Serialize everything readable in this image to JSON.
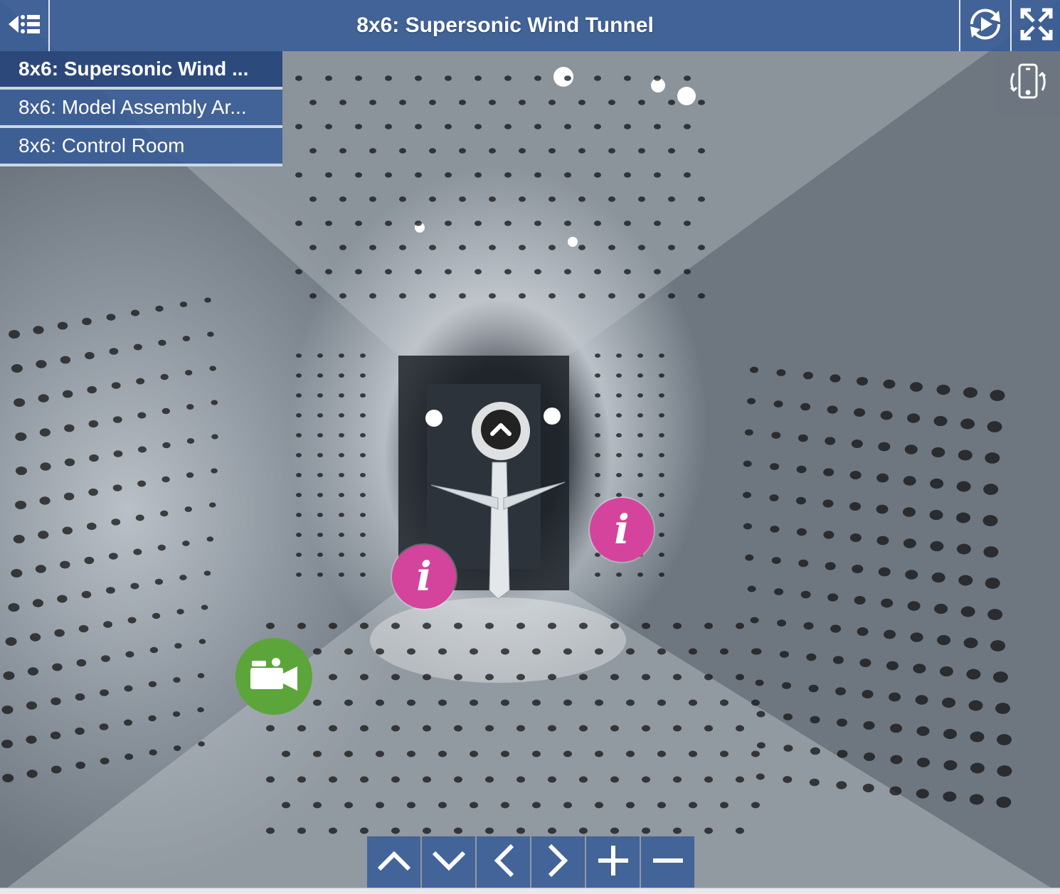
{
  "header": {
    "title": "8x6: Supersonic Wind Tunnel",
    "menu_icon": "menu-collapse-icon",
    "autoplay_icon": "autorotate-play-icon",
    "fullscreen_icon": "fullscreen-icon"
  },
  "gyro": {
    "icon": "device-orientation-icon"
  },
  "scene_list": {
    "items": [
      {
        "label": "8x6: Supersonic Wind ...",
        "active": true
      },
      {
        "label": "8x6: Model Assembly Ar...",
        "active": false
      },
      {
        "label": "8x6: Control Room",
        "active": false
      }
    ]
  },
  "hotspots": {
    "nav": {
      "icon": "chevron-up-icon"
    },
    "info": {
      "glyph": "i",
      "icon": "info-icon"
    },
    "video": {
      "icon": "video-camera-icon"
    }
  },
  "controls": [
    {
      "icon": "arrow-up-icon"
    },
    {
      "icon": "arrow-down-icon"
    },
    {
      "icon": "arrow-left-icon"
    },
    {
      "icon": "arrow-right-icon"
    },
    {
      "icon": "zoom-in-icon"
    },
    {
      "icon": "zoom-out-icon"
    }
  ],
  "colors": {
    "bar": "#385c96",
    "info_hotspot": "#d4449c",
    "video_hotspot": "#5ca53a"
  }
}
